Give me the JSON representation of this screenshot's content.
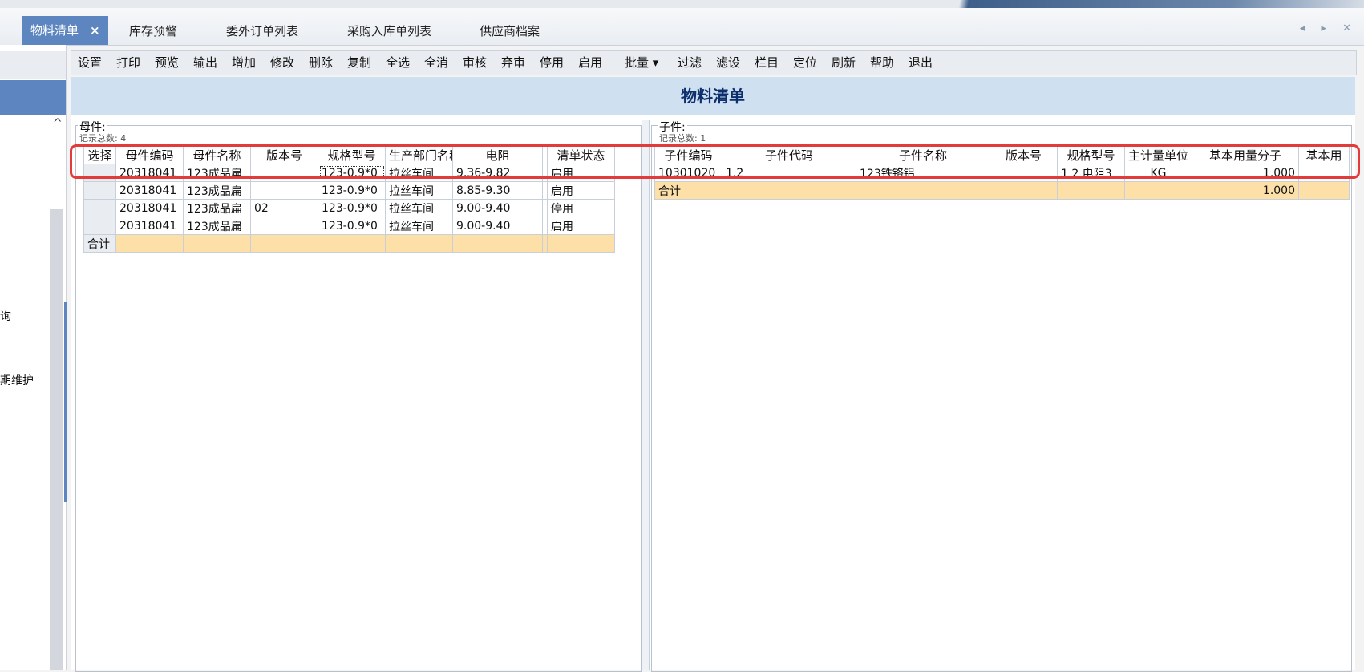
{
  "tabs": [
    {
      "label": "物料清单",
      "close": "×",
      "active": true
    },
    {
      "label": "库存预警"
    },
    {
      "label": "委外订单列表"
    },
    {
      "label": "采购入库单列表"
    },
    {
      "label": "供应商档案"
    }
  ],
  "window_controls": "◂ ▸ ✕",
  "left_nav": {
    "item1": "询",
    "item2": "期维护",
    "scroll_up": "^"
  },
  "toolbar": [
    "设置",
    "打印",
    "预览",
    "输出",
    "增加",
    "修改",
    "删除",
    "复制",
    "全选",
    "全消",
    "审核",
    "弃审",
    "停用",
    "启用",
    "批量 ▾",
    "过滤",
    "滤设",
    "栏目",
    "定位",
    "刷新",
    "帮助",
    "退出"
  ],
  "page_title": "物料清单",
  "parent": {
    "group_label": "母件:",
    "count_text": "记录总数: 4",
    "columns": [
      "选择",
      "母件编码",
      "母件名称",
      "版本号",
      "规格型号",
      "生产部门名称",
      "电阻",
      "",
      "清单状态"
    ],
    "rows": [
      [
        "",
        "20318041",
        "123成品扁",
        "",
        "123-0.9*0",
        "拉丝车间",
        "9.36-9.82",
        "",
        "启用"
      ],
      [
        "",
        "20318041",
        "123成品扁",
        "",
        "123-0.9*0",
        "拉丝车间",
        "8.85-9.30",
        "",
        "启用"
      ],
      [
        "",
        "20318041",
        "123成品扁",
        "02",
        "123-0.9*0",
        "拉丝车间",
        "9.00-9.40",
        "",
        "停用"
      ],
      [
        "",
        "20318041",
        "123成品扁",
        "",
        "123-0.9*0",
        "拉丝车间",
        "9.00-9.40",
        "",
        "启用"
      ]
    ],
    "total_label": "合计"
  },
  "child": {
    "group_label": "子件:",
    "count_text": "记录总数: 1",
    "columns": [
      "子件编码",
      "子件代码",
      "子件名称",
      "版本号",
      "规格型号",
      "主计量单位",
      "基本用量分子",
      "基本用"
    ],
    "rows": [
      [
        "10301020",
        "1.2",
        "123铁铬铝",
        "",
        "1.2 电阻3",
        "KG",
        "1.000",
        ""
      ]
    ],
    "total_label": "合计",
    "total_value": "1.000"
  },
  "colors": {
    "accent": "#5d86c0",
    "title": "#0d2f6e",
    "total_row": "#fde0a8",
    "highlight_box": "#e33a3a"
  }
}
